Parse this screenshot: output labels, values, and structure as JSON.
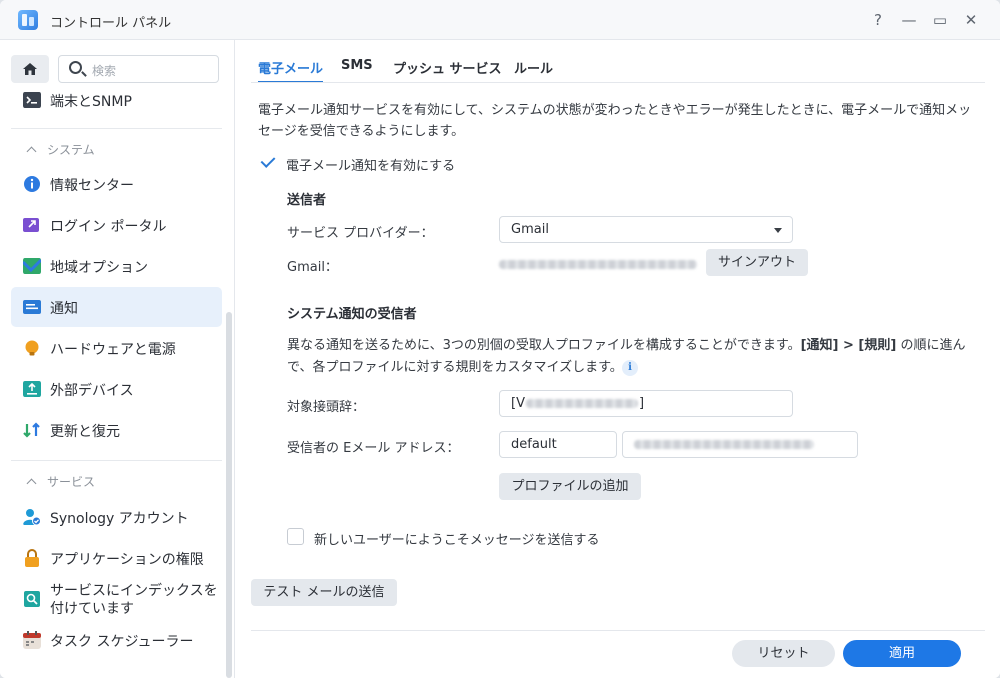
{
  "window": {
    "title": "コントロール パネル",
    "controls": [
      "?",
      "—",
      "▭",
      "✕"
    ]
  },
  "sidebar": {
    "search_placeholder": "検索",
    "items": [
      {
        "label": "端末とSNMP",
        "icon": "terminal-icon",
        "color": "#3c4450"
      },
      {
        "label": "情報センター",
        "icon": "info-center-icon",
        "color": "#2d7ae0"
      },
      {
        "label": "ログイン ポータル",
        "icon": "login-portal-icon",
        "color": "#7a4fd1"
      },
      {
        "label": "地域オプション",
        "icon": "regional-options-icon",
        "color": "#2fa86a"
      },
      {
        "label": "通知",
        "icon": "notification-icon",
        "color": "#2a7ad6",
        "active": true
      },
      {
        "label": "ハードウェアと電源",
        "icon": "hardware-power-icon",
        "color": "#f0a020"
      },
      {
        "label": "外部デバイス",
        "icon": "external-devices-icon",
        "color": "#1fa6a0"
      },
      {
        "label": "更新と復元",
        "icon": "update-restore-icon",
        "color": "#2fa86a"
      },
      {
        "label": "Synology アカウント",
        "icon": "synology-account-icon",
        "color": "#1f9ad6"
      },
      {
        "label": "アプリケーションの権限",
        "icon": "app-privileges-icon",
        "color": "#f0a020"
      },
      {
        "label": "サービスにインデックスを付けています",
        "icon": "indexing-service-icon",
        "color": "#1fa6a0"
      },
      {
        "label": "タスク スケジューラー",
        "icon": "task-scheduler-icon",
        "color": "#c0392b"
      }
    ],
    "sections": [
      "システム",
      "サービス"
    ]
  },
  "tabs": [
    "電子メール",
    "SMS",
    "プッシュ サービス",
    "ルール"
  ],
  "email": {
    "description": "電子メール通知サービスを有効にして、システムの状態が変わったときやエラーが発生したときに、電子メールで通知メッセージを受信できるようにします。",
    "enable_label": "電子メール通知を有効にする",
    "sender_heading": "送信者",
    "provider_label": "サービス プロバイダー：",
    "provider_value": "Gmail",
    "gmail_label": "Gmail：",
    "signout_label": "サインアウト",
    "recipients_heading": "システム通知の受信者",
    "recipients_desc_1": "異なる通知を送るために、3つの別個の受取人プロファイルを構成することができます。",
    "recipients_desc_bold": "[通知] > [規則]",
    "recipients_desc_2": "の順に進んで、各プロファイルに対する規則をカスタマイズします。",
    "prefix_label": "対象接頭辞：",
    "prefix_value_start": "[V",
    "prefix_value_end": "]",
    "address_label": "受信者の Eメール アドレス：",
    "address_profile": "default",
    "add_profile_label": "プロファイルの追加",
    "welcome_label": "新しいユーザーにようこそメッセージを送信する",
    "test_label": "テスト メールの送信"
  },
  "footer": {
    "reset": "リセット",
    "apply": "適用"
  },
  "colors": {
    "accent": "#2a7ad6",
    "apply_bg": "#1e78e6"
  }
}
